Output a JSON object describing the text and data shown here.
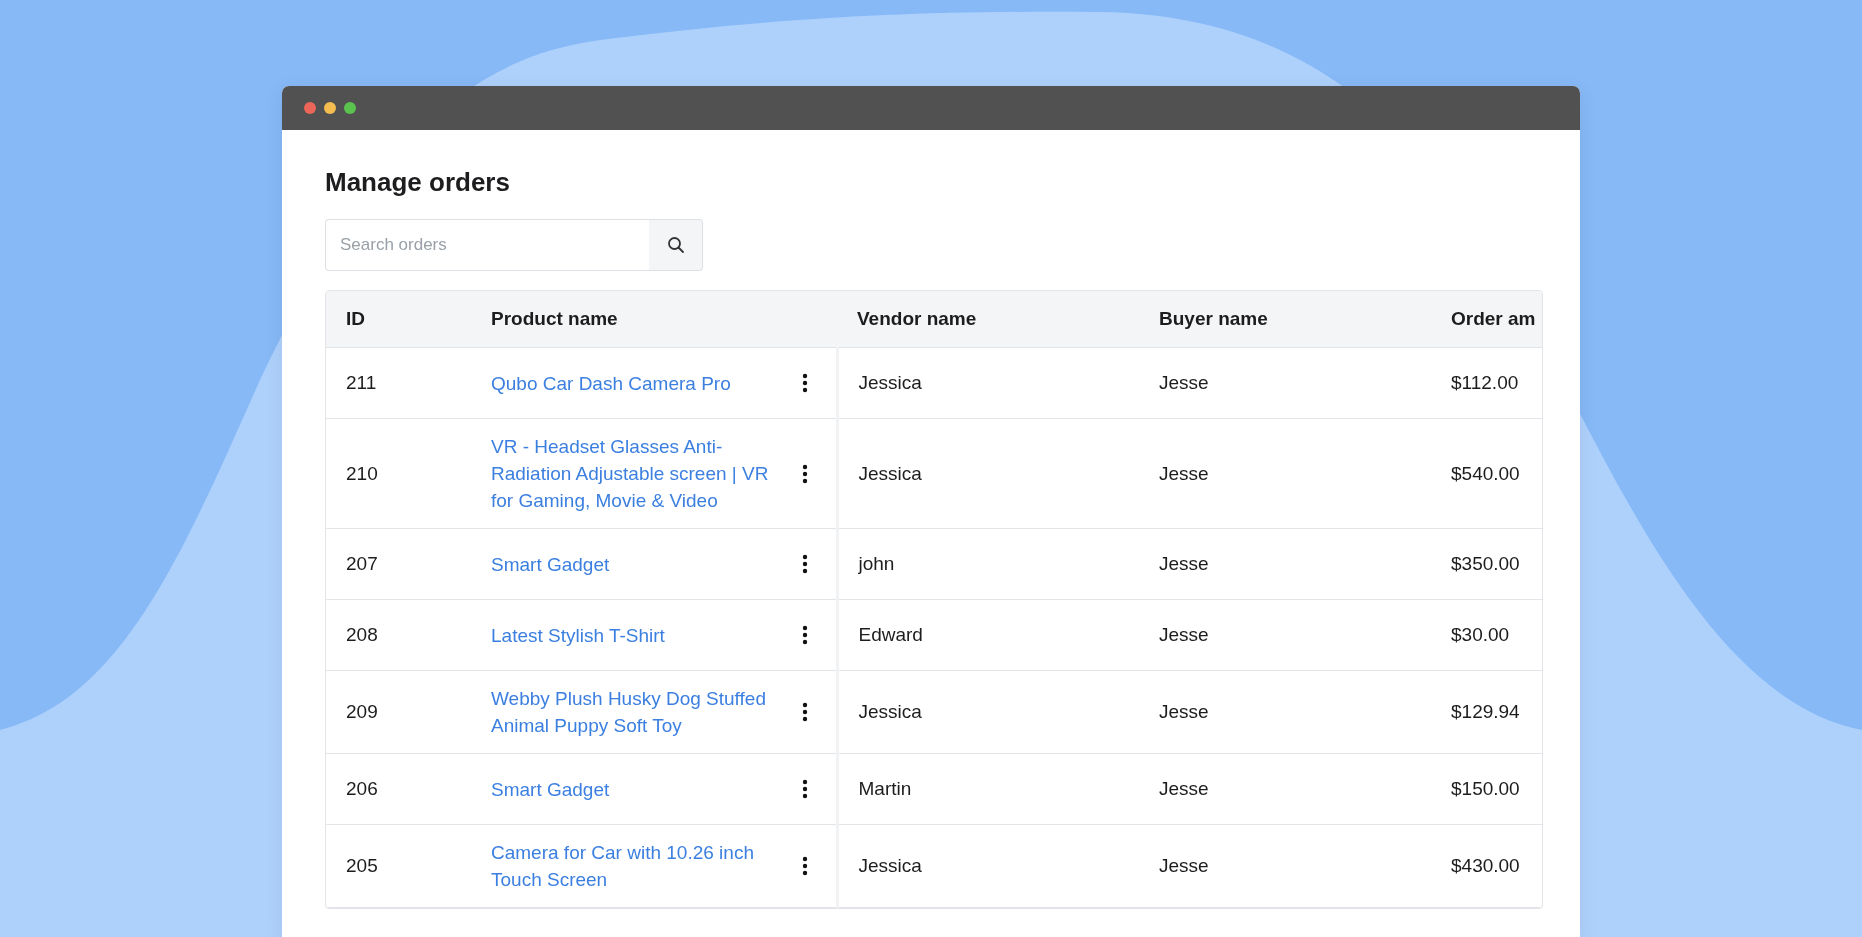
{
  "page_title": "Manage orders",
  "search": {
    "placeholder": "Search orders"
  },
  "table": {
    "columns": [
      "ID",
      "Product name",
      "Vendor name",
      "Buyer name",
      "Order am"
    ],
    "rows": [
      {
        "id": "211",
        "product": "Qubo Car Dash Camera Pro",
        "vendor": "Jessica",
        "buyer": "Jesse",
        "amount": "$112.00"
      },
      {
        "id": "210",
        "product": "VR - Headset Glasses Anti-Radiation Adjustable screen | VR for Gaming, Movie & Video",
        "vendor": "Jessica",
        "buyer": "Jesse",
        "amount": "$540.00"
      },
      {
        "id": "207",
        "product": "Smart Gadget",
        "vendor": "john",
        "buyer": "Jesse",
        "amount": "$350.00"
      },
      {
        "id": "208",
        "product": "Latest Stylish T-Shirt",
        "vendor": "Edward",
        "buyer": "Jesse",
        "amount": "$30.00"
      },
      {
        "id": "209",
        "product": "Webby Plush Husky Dog Stuffed Animal Puppy Soft Toy",
        "vendor": "Jessica",
        "buyer": "Jesse",
        "amount": "$129.94"
      },
      {
        "id": "206",
        "product": "Smart Gadget",
        "vendor": "Martin",
        "buyer": "Jesse",
        "amount": "$150.00"
      },
      {
        "id": "205",
        "product": "Camera for Car with 10.26 inch Touch Screen",
        "vendor": "Jessica",
        "buyer": "Jesse",
        "amount": "$430.00"
      }
    ]
  }
}
